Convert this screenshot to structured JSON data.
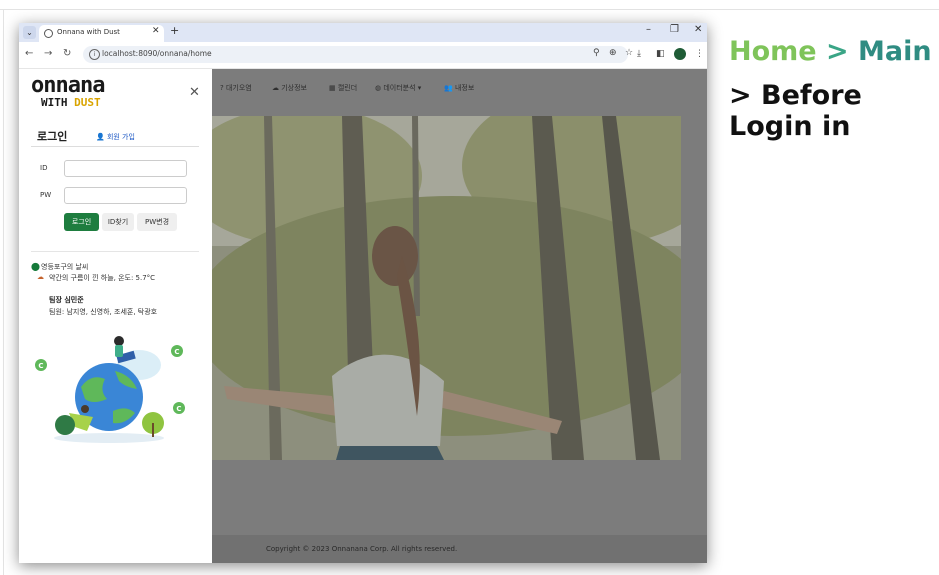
{
  "annotation": {
    "crumb_home": "Home",
    "crumb_sep": " > ",
    "crumb_main": "Main",
    "subtitle": "> Before Login in"
  },
  "browser": {
    "tab_title": "Onnana with Dust",
    "url": "localhost:8090/onnana/home"
  },
  "nav": {
    "items": [
      "? 대기오염",
      "기상정보",
      "캘린더",
      "데이터분석",
      "내정보"
    ]
  },
  "sidebar": {
    "logo_line1": "onnana",
    "logo_line2a": "WITH ",
    "logo_line2b": "DUST",
    "login_heading": "로그인",
    "signup_link": "회원 가입",
    "id_label": "ID",
    "pw_label": "PW",
    "id_value": "",
    "pw_value": "",
    "login_button": "로그인",
    "find_id_button": "ID찾기",
    "change_pw_button": "PW변경",
    "weather_location": "영등포구의 날씨",
    "weather_desc": "약간의 구름이 낀 하늘, 온도: 5.7°C",
    "team_lead": "팀장 심민준",
    "team_members": "팀원: 남지영, 신영하, 조세훈, 탁광호"
  },
  "footer": {
    "copyright": "Copyright © 2023 Onnanana Corp. All rights reserved."
  },
  "icons": [
    "dropdown-icon",
    "globe-icon",
    "close-icon",
    "plus-icon",
    "minimize-icon",
    "restore-icon",
    "back-arrow-icon",
    "forward-arrow-icon",
    "reload-icon",
    "info-icon",
    "location-icon",
    "zoom-icon",
    "star-icon",
    "download-icon",
    "sidepanel-icon",
    "menu-icon",
    "cloud-icon",
    "calendar-icon",
    "chart-icon",
    "user-icon",
    "user-plus-icon",
    "map-pin-icon",
    "weather-icon"
  ],
  "colors": {
    "primary_button": "#1e7d3f",
    "logo_accent": "#d9a400",
    "annotation_home": "#7fc45a",
    "annotation_main": "#2f8c82",
    "overlay": "#7c7c7c"
  }
}
